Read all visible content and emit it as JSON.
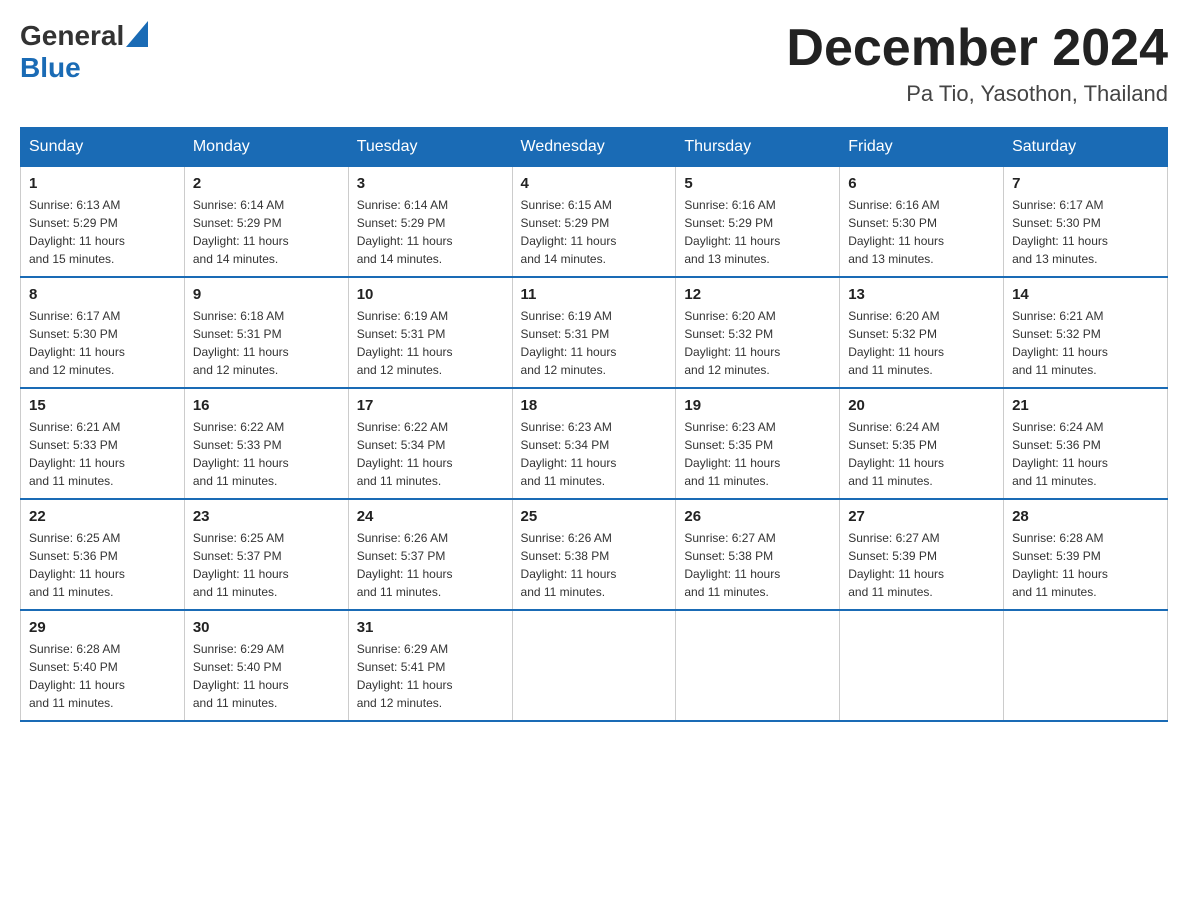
{
  "header": {
    "logo_general": "General",
    "logo_blue": "Blue",
    "month_title": "December 2024",
    "location": "Pa Tio, Yasothon, Thailand"
  },
  "days_of_week": [
    "Sunday",
    "Monday",
    "Tuesday",
    "Wednesday",
    "Thursday",
    "Friday",
    "Saturday"
  ],
  "weeks": [
    [
      {
        "day": "1",
        "sunrise": "6:13 AM",
        "sunset": "5:29 PM",
        "daylight": "11 hours and 15 minutes."
      },
      {
        "day": "2",
        "sunrise": "6:14 AM",
        "sunset": "5:29 PM",
        "daylight": "11 hours and 14 minutes."
      },
      {
        "day": "3",
        "sunrise": "6:14 AM",
        "sunset": "5:29 PM",
        "daylight": "11 hours and 14 minutes."
      },
      {
        "day": "4",
        "sunrise": "6:15 AM",
        "sunset": "5:29 PM",
        "daylight": "11 hours and 14 minutes."
      },
      {
        "day": "5",
        "sunrise": "6:16 AM",
        "sunset": "5:29 PM",
        "daylight": "11 hours and 13 minutes."
      },
      {
        "day": "6",
        "sunrise": "6:16 AM",
        "sunset": "5:30 PM",
        "daylight": "11 hours and 13 minutes."
      },
      {
        "day": "7",
        "sunrise": "6:17 AM",
        "sunset": "5:30 PM",
        "daylight": "11 hours and 13 minutes."
      }
    ],
    [
      {
        "day": "8",
        "sunrise": "6:17 AM",
        "sunset": "5:30 PM",
        "daylight": "11 hours and 12 minutes."
      },
      {
        "day": "9",
        "sunrise": "6:18 AM",
        "sunset": "5:31 PM",
        "daylight": "11 hours and 12 minutes."
      },
      {
        "day": "10",
        "sunrise": "6:19 AM",
        "sunset": "5:31 PM",
        "daylight": "11 hours and 12 minutes."
      },
      {
        "day": "11",
        "sunrise": "6:19 AM",
        "sunset": "5:31 PM",
        "daylight": "11 hours and 12 minutes."
      },
      {
        "day": "12",
        "sunrise": "6:20 AM",
        "sunset": "5:32 PM",
        "daylight": "11 hours and 12 minutes."
      },
      {
        "day": "13",
        "sunrise": "6:20 AM",
        "sunset": "5:32 PM",
        "daylight": "11 hours and 11 minutes."
      },
      {
        "day": "14",
        "sunrise": "6:21 AM",
        "sunset": "5:32 PM",
        "daylight": "11 hours and 11 minutes."
      }
    ],
    [
      {
        "day": "15",
        "sunrise": "6:21 AM",
        "sunset": "5:33 PM",
        "daylight": "11 hours and 11 minutes."
      },
      {
        "day": "16",
        "sunrise": "6:22 AM",
        "sunset": "5:33 PM",
        "daylight": "11 hours and 11 minutes."
      },
      {
        "day": "17",
        "sunrise": "6:22 AM",
        "sunset": "5:34 PM",
        "daylight": "11 hours and 11 minutes."
      },
      {
        "day": "18",
        "sunrise": "6:23 AM",
        "sunset": "5:34 PM",
        "daylight": "11 hours and 11 minutes."
      },
      {
        "day": "19",
        "sunrise": "6:23 AM",
        "sunset": "5:35 PM",
        "daylight": "11 hours and 11 minutes."
      },
      {
        "day": "20",
        "sunrise": "6:24 AM",
        "sunset": "5:35 PM",
        "daylight": "11 hours and 11 minutes."
      },
      {
        "day": "21",
        "sunrise": "6:24 AM",
        "sunset": "5:36 PM",
        "daylight": "11 hours and 11 minutes."
      }
    ],
    [
      {
        "day": "22",
        "sunrise": "6:25 AM",
        "sunset": "5:36 PM",
        "daylight": "11 hours and 11 minutes."
      },
      {
        "day": "23",
        "sunrise": "6:25 AM",
        "sunset": "5:37 PM",
        "daylight": "11 hours and 11 minutes."
      },
      {
        "day": "24",
        "sunrise": "6:26 AM",
        "sunset": "5:37 PM",
        "daylight": "11 hours and 11 minutes."
      },
      {
        "day": "25",
        "sunrise": "6:26 AM",
        "sunset": "5:38 PM",
        "daylight": "11 hours and 11 minutes."
      },
      {
        "day": "26",
        "sunrise": "6:27 AM",
        "sunset": "5:38 PM",
        "daylight": "11 hours and 11 minutes."
      },
      {
        "day": "27",
        "sunrise": "6:27 AM",
        "sunset": "5:39 PM",
        "daylight": "11 hours and 11 minutes."
      },
      {
        "day": "28",
        "sunrise": "6:28 AM",
        "sunset": "5:39 PM",
        "daylight": "11 hours and 11 minutes."
      }
    ],
    [
      {
        "day": "29",
        "sunrise": "6:28 AM",
        "sunset": "5:40 PM",
        "daylight": "11 hours and 11 minutes."
      },
      {
        "day": "30",
        "sunrise": "6:29 AM",
        "sunset": "5:40 PM",
        "daylight": "11 hours and 11 minutes."
      },
      {
        "day": "31",
        "sunrise": "6:29 AM",
        "sunset": "5:41 PM",
        "daylight": "11 hours and 12 minutes."
      },
      null,
      null,
      null,
      null
    ]
  ],
  "labels": {
    "sunrise": "Sunrise:",
    "sunset": "Sunset:",
    "daylight": "Daylight:"
  }
}
